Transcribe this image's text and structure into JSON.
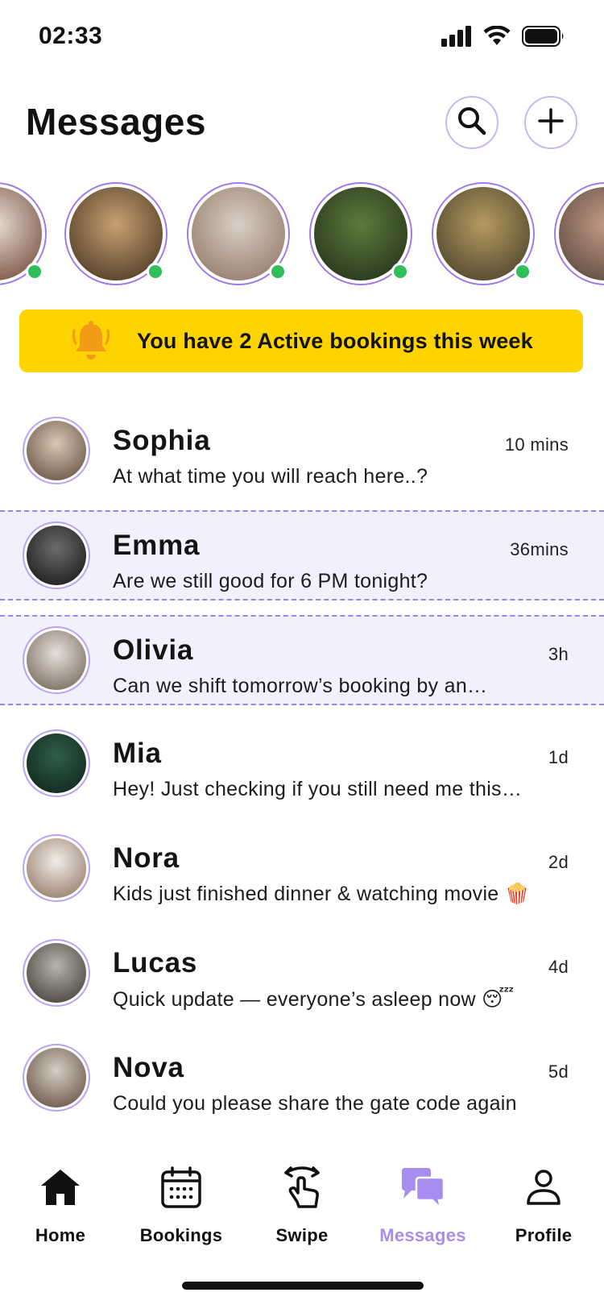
{
  "status_bar": {
    "time": "02:33"
  },
  "header": {
    "title": "Messages"
  },
  "stories": [
    {
      "name": "story-1",
      "online": true,
      "colors": [
        "#e7ded4",
        "#6b3c2e"
      ]
    },
    {
      "name": "story-2",
      "online": true,
      "colors": [
        "#c9a071",
        "#3d2d1d"
      ]
    },
    {
      "name": "story-3",
      "online": true,
      "colors": [
        "#d9cfc6",
        "#8a6f5d"
      ]
    },
    {
      "name": "story-4",
      "online": true,
      "colors": [
        "#5d7b3b",
        "#1f2b18"
      ]
    },
    {
      "name": "story-5",
      "online": true,
      "colors": [
        "#b69a61",
        "#3f3a26"
      ]
    },
    {
      "name": "story-6",
      "online": false,
      "colors": [
        "#c49a86",
        "#4e4038"
      ]
    }
  ],
  "banner": {
    "text": "You have 2 Active bookings this week"
  },
  "chats": [
    {
      "name": "Sophia",
      "time": "10 mins",
      "message": "At what time you will reach here..?",
      "highlight": false
    },
    {
      "name": "Emma",
      "time": "36mins",
      "message": "Are we still good for 6 PM tonight?",
      "highlight": true
    },
    {
      "name": "Olivia",
      "time": "3h",
      "message": "Can we shift tomorrow’s booking by an…",
      "highlight": true
    },
    {
      "name": "Mia",
      "time": "1d",
      "message": "Hey! Just checking if you still need me this…",
      "highlight": false
    },
    {
      "name": "Nora",
      "time": "2d",
      "message": "Kids just finished dinner & watching movie 🍿",
      "highlight": false
    },
    {
      "name": "Lucas",
      "time": "4d",
      "message": "Quick update — everyone’s asleep now 😴",
      "highlight": false
    },
    {
      "name": "Nova",
      "time": "5d",
      "message": "Could you please share the gate code again",
      "highlight": false
    }
  ],
  "nav": {
    "home": "Home",
    "bookings": "Bookings",
    "swipe": "Swipe",
    "messages": "Messages",
    "profile": "Profile"
  },
  "colors": {
    "accent": "#a88cf0",
    "banner": "#fdd402",
    "online": "#2fbf5a",
    "highlight_bg": "#f3f0fd"
  }
}
